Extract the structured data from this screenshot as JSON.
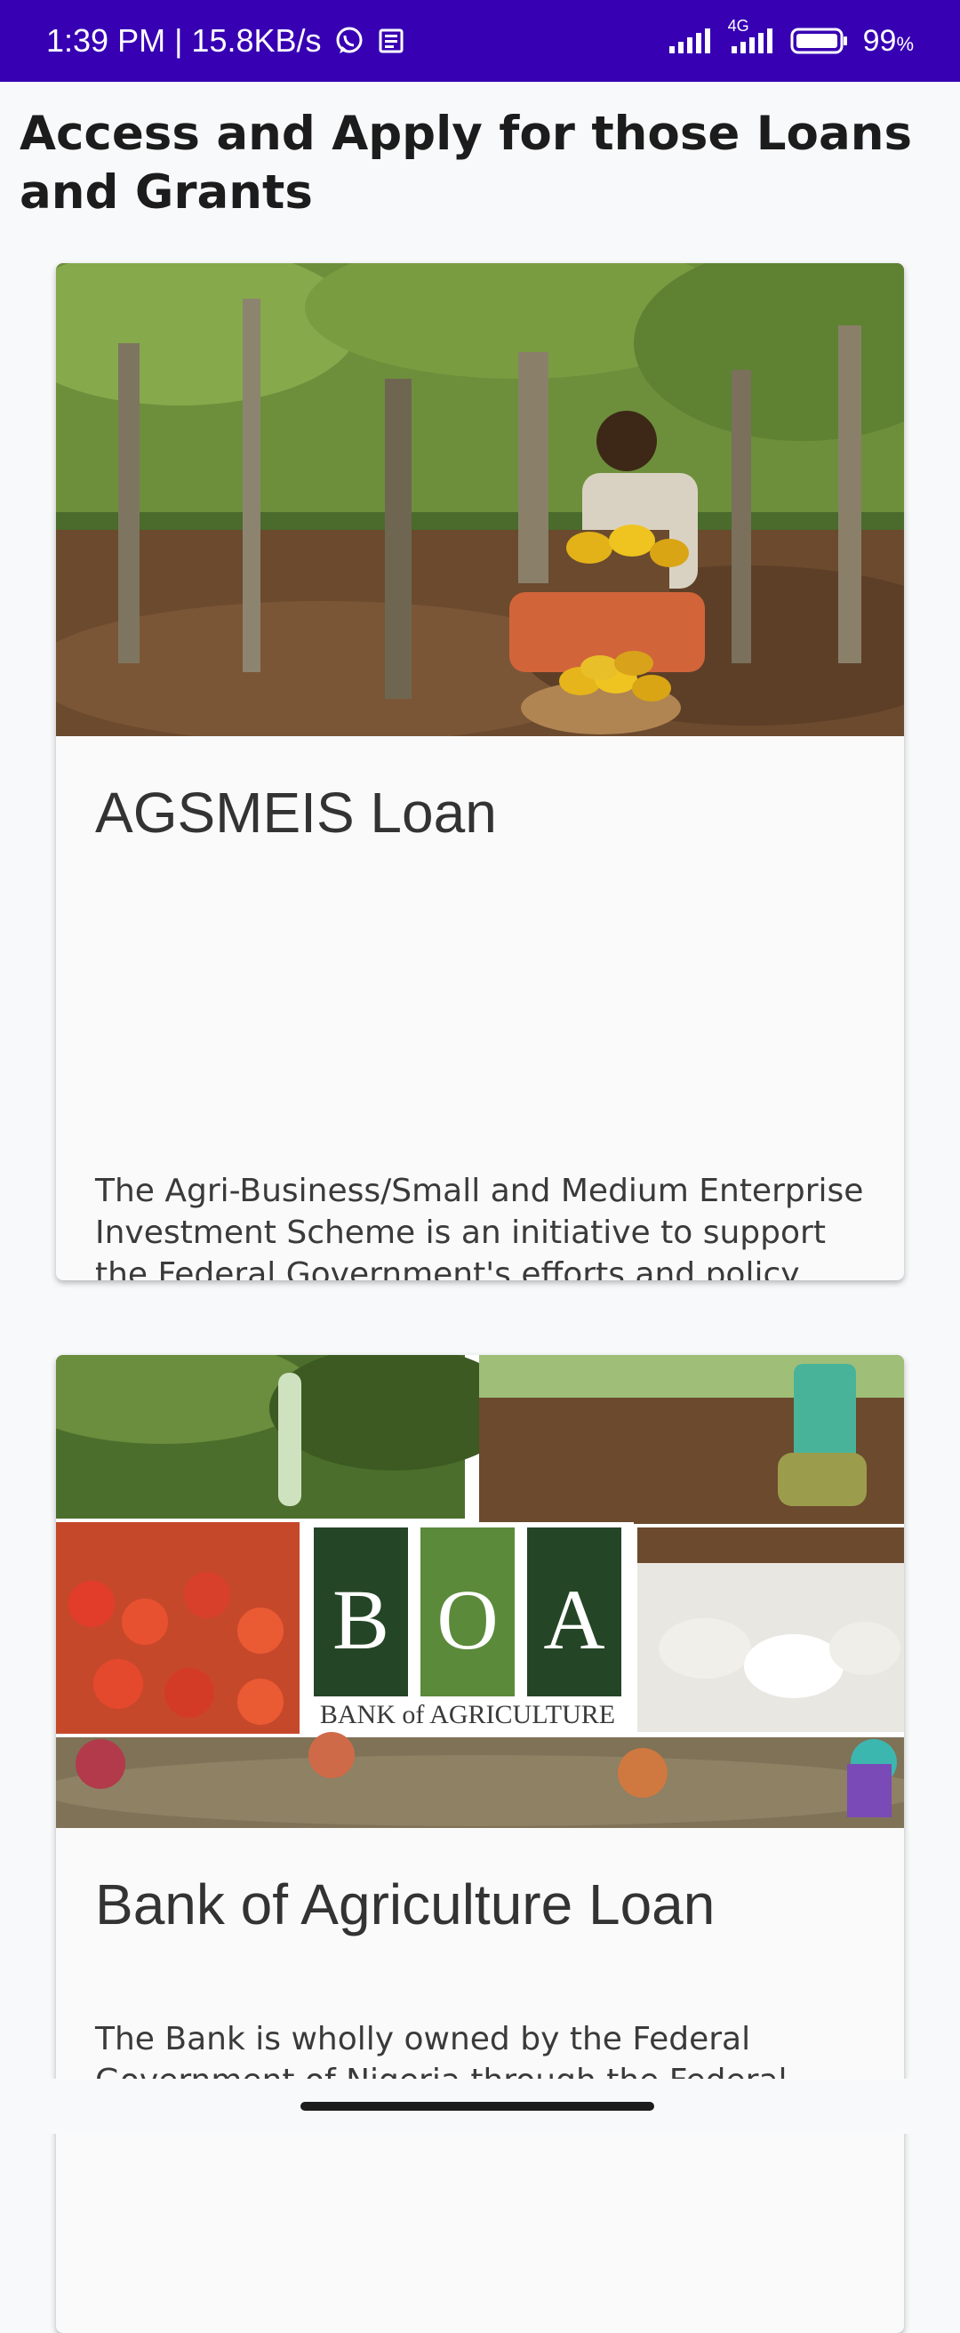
{
  "status_bar": {
    "time_speed": "1:39 PM | 15.8KB/s",
    "network_type": "4G",
    "battery_level": "99",
    "battery_unit": "%",
    "icons": [
      "whatsapp-icon",
      "news-icon",
      "signal-icon",
      "signal-4g-icon",
      "battery-icon"
    ]
  },
  "page": {
    "title": "Access and Apply for those Loans and Grants"
  },
  "cards": [
    {
      "title": "AGSMEIS Loan",
      "description": "The Agri-Business/Small and Medium Enterprise Investment Scheme is an initiative to support the Federal Government's efforts and policy measures for the promotion of agricultural businesses and small/medium enterprises (SMEs) as vehicles for sustainable economic development and employment generation",
      "image": "cocoa-farmer-photo"
    },
    {
      "title": "Bank of Agriculture Loan",
      "description": "The Bank is wholly owned by the Federal Government of Nigeria through the Federal",
      "image": "bank-of-agriculture-collage",
      "logo_letters": [
        "B",
        "O",
        "A"
      ],
      "logo_text": "BANK of AGRICULTURE"
    }
  ],
  "colors": {
    "status_bar": "#3700b3",
    "background": "#f8f9fa",
    "card_background": "#fafafa"
  }
}
